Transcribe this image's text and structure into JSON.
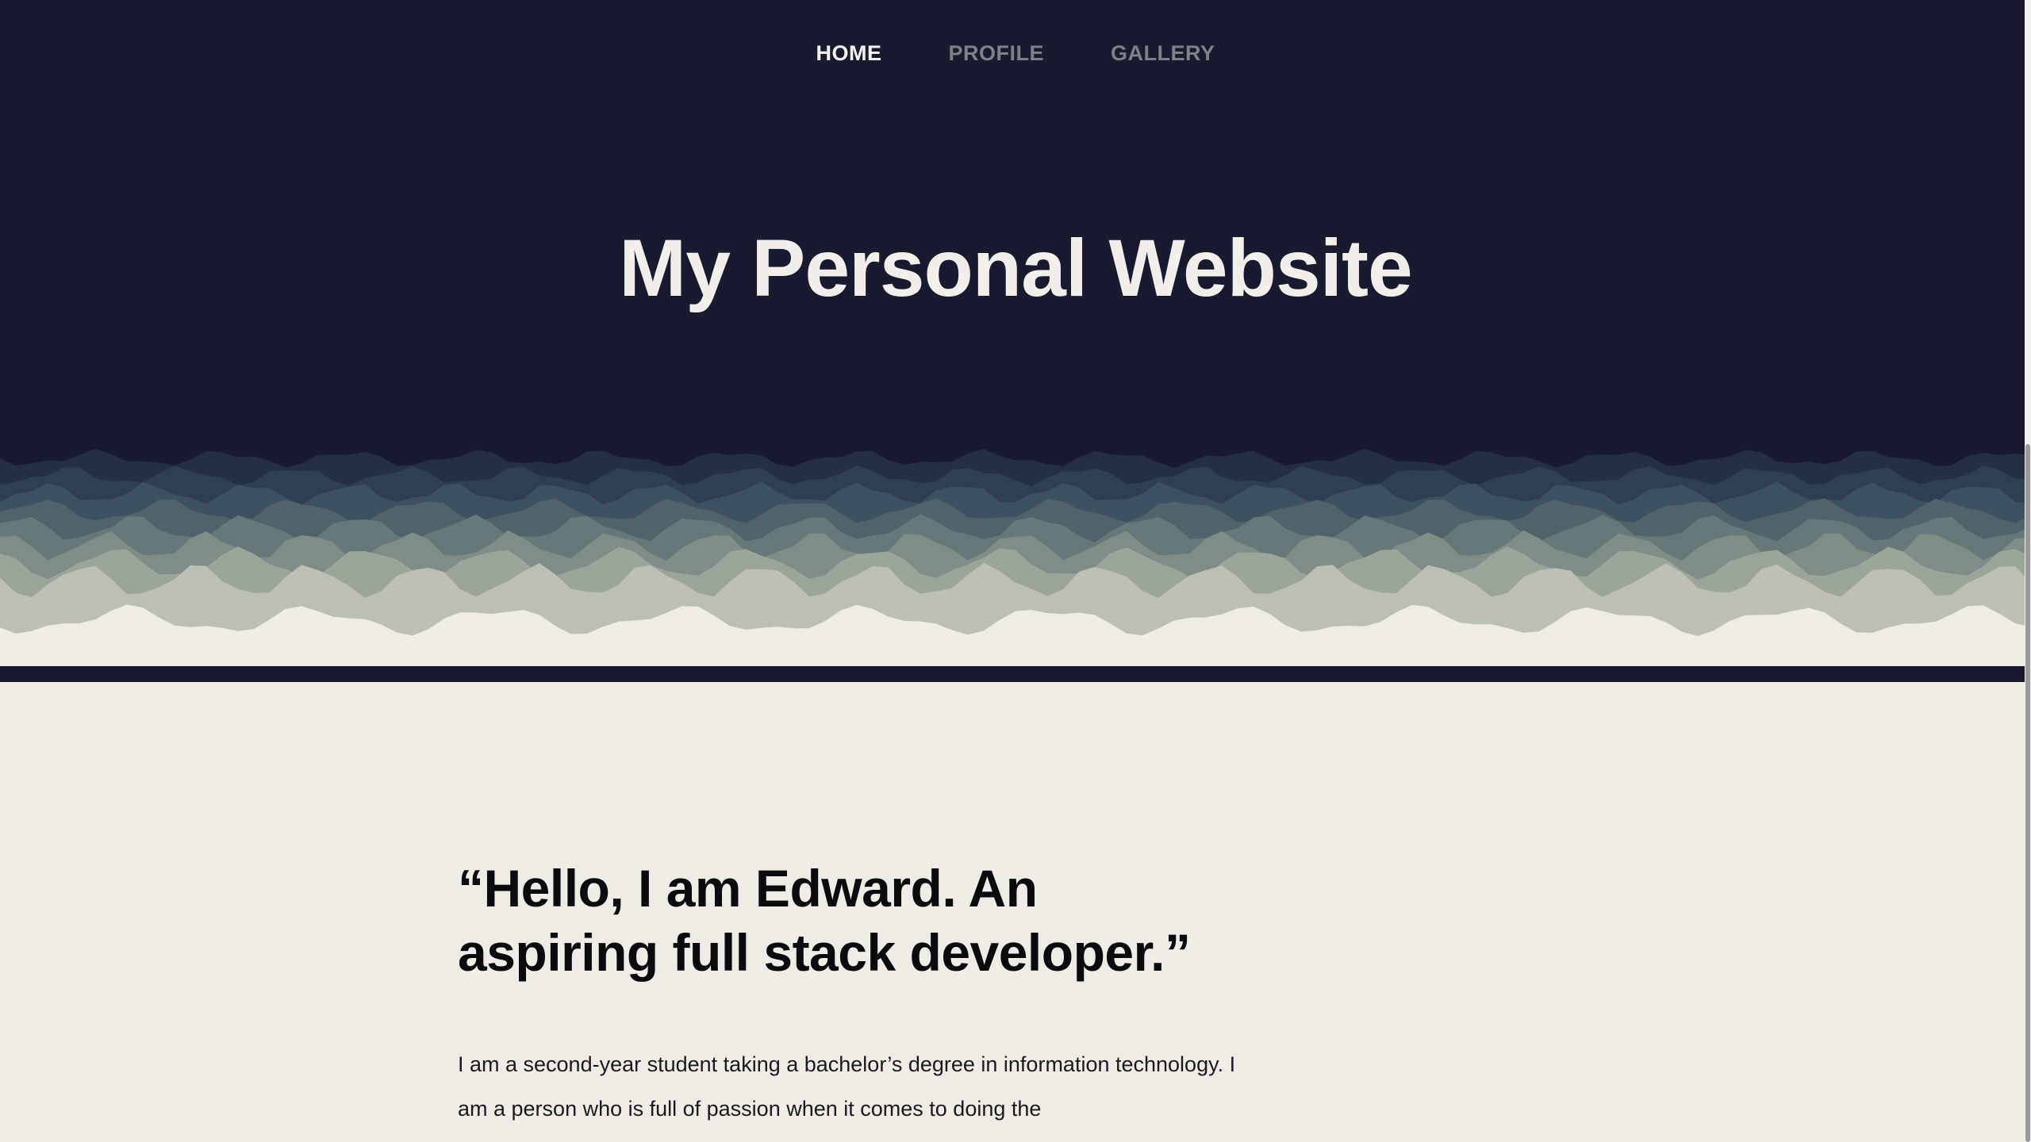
{
  "nav": {
    "items": [
      {
        "label": "HOME",
        "active": true
      },
      {
        "label": "PROFILE",
        "active": false
      },
      {
        "label": "GALLERY",
        "active": false
      }
    ]
  },
  "hero": {
    "title": "My Personal Website"
  },
  "intro": {
    "quote": "“Hello, I am Edward. An aspiring full stack developer.”",
    "bio": "I am a second-year student taking a bachelor’s degree in information technology. I am a person who is full of passion when it comes to doing the"
  },
  "colors": {
    "hero_bg": "#181b30",
    "page_bg": "#efece6",
    "nav_active": "#f4f2ee",
    "nav_inactive": "#7f8088",
    "wave_layers": [
      "#242f44",
      "#2f3f52",
      "#3e5160",
      "#50636b",
      "#66787a",
      "#7f8d86",
      "#9ba599",
      "#bbbfb4"
    ]
  }
}
